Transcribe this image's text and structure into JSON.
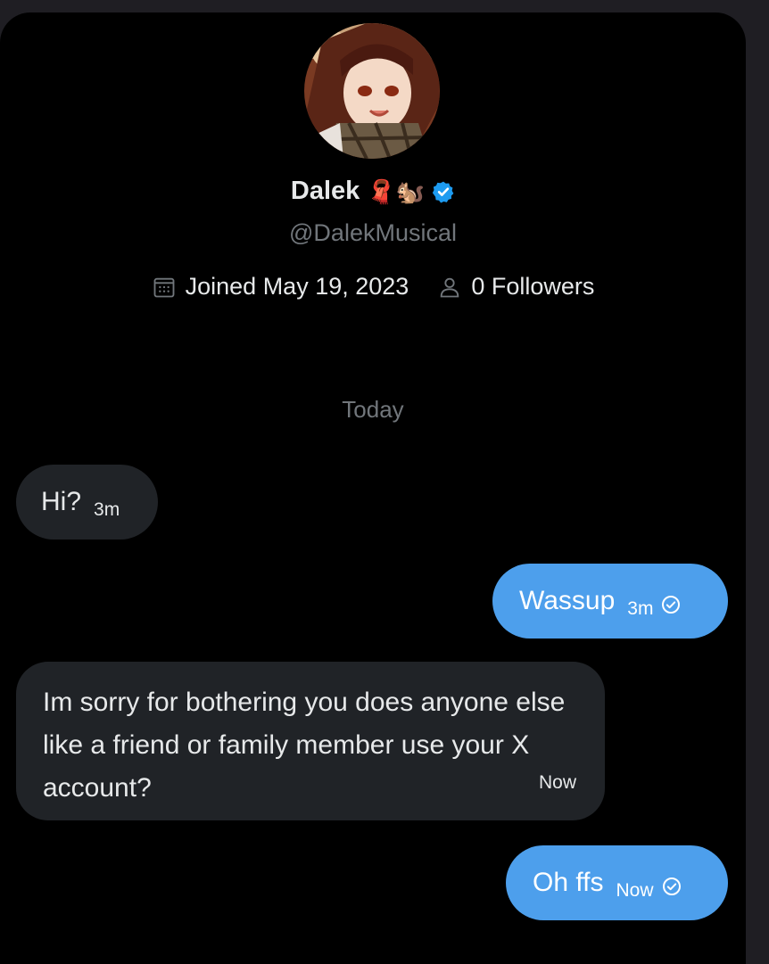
{
  "profile": {
    "name": "Dalek",
    "emojis": "🧣🐿️",
    "handle": "@DalekMusical",
    "joined": "Joined May 19, 2023",
    "followers": "0 Followers"
  },
  "conversation": {
    "date_divider": "Today",
    "messages": [
      {
        "direction": "incoming",
        "text": "Hi?",
        "time": "3m"
      },
      {
        "direction": "outgoing",
        "text": "Wassup",
        "time": "3m",
        "status": "check-circle-icon"
      },
      {
        "direction": "incoming",
        "text": "Im sorry for bothering you does anyone else like a friend or family member use your X account?",
        "time": "Now"
      },
      {
        "direction": "outgoing",
        "text": "Oh ffs",
        "time": "Now",
        "status": "check-circle-icon"
      }
    ]
  },
  "colors": {
    "background": "#000000",
    "outer": "#1f1e23",
    "incoming_bubble": "#202327",
    "outgoing_bubble": "#4d9fec",
    "secondary_text": "#71767b",
    "verified": "#1d9bf0"
  }
}
